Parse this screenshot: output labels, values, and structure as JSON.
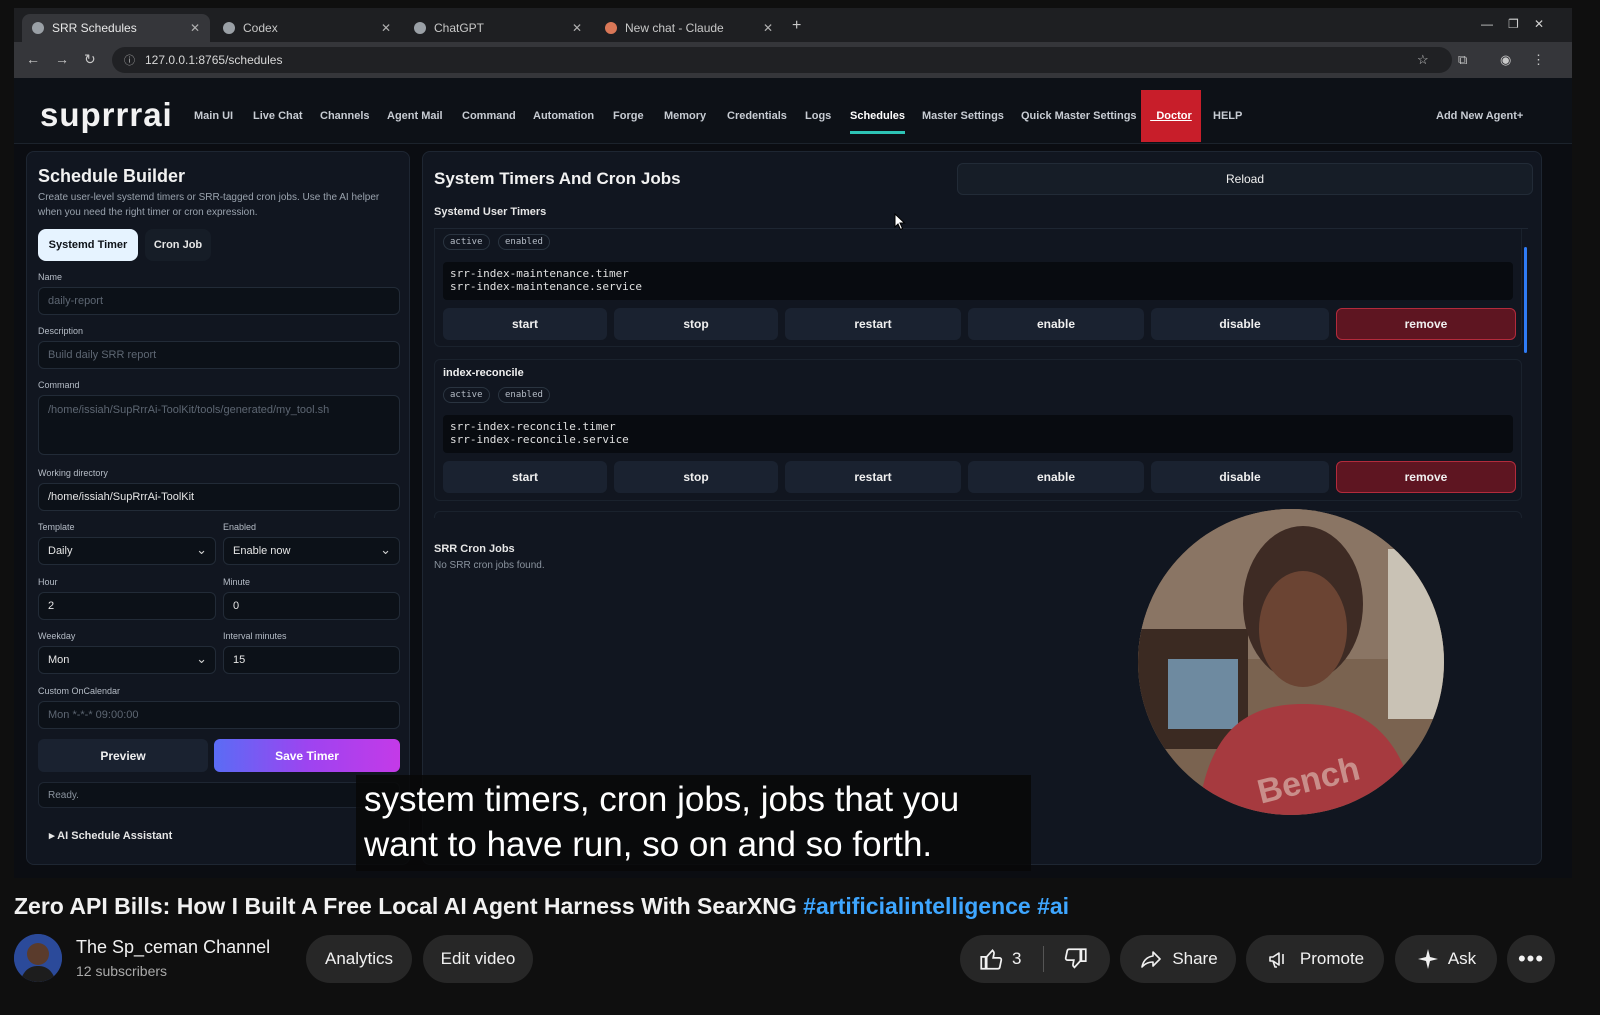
{
  "browser": {
    "tabs": [
      {
        "label": "SRR Schedules",
        "active": true
      },
      {
        "label": "Codex",
        "active": false
      },
      {
        "label": "ChatGPT",
        "active": false
      },
      {
        "label": "New chat - Claude",
        "active": false
      }
    ],
    "url": "127.0.0.1:8765/schedules"
  },
  "app": {
    "logo": "suprrrai",
    "nav": [
      "Main UI",
      "Live Chat",
      "Channels",
      "Agent Mail",
      "Command",
      "Automation",
      "Forge",
      "Memory",
      "Credentials",
      "Logs",
      "Schedules",
      "Master Settings",
      "Quick Master Settings",
      "_Doctor",
      "HELP"
    ],
    "active_nav": "Schedules",
    "add_agent": "Add New Agent+"
  },
  "builder": {
    "title": "Schedule Builder",
    "description": "Create user-level systemd timers or SRR-tagged cron jobs. Use the AI helper when you need the right timer or cron expression.",
    "mode_tabs": [
      "Systemd Timer",
      "Cron Job"
    ],
    "name_label": "Name",
    "name_placeholder": "daily-report",
    "desc_label": "Description",
    "desc_placeholder": "Build daily SRR report",
    "command_label": "Command",
    "command_placeholder": "/home/issiah/SupRrrAi-ToolKit/tools/generated/my_tool.sh",
    "workdir_label": "Working directory",
    "workdir_value": "/home/issiah/SupRrrAi-ToolKit",
    "template_label": "Template",
    "template_value": "Daily",
    "enabled_label": "Enabled",
    "enabled_value": "Enable now",
    "hour_label": "Hour",
    "hour_value": "2",
    "minute_label": "Minute",
    "minute_value": "0",
    "weekday_label": "Weekday",
    "weekday_value": "Mon",
    "interval_label": "Interval minutes",
    "interval_value": "15",
    "oncal_label": "Custom OnCalendar",
    "oncal_placeholder": "Mon *-*-* 09:00:00",
    "preview_label": "Preview",
    "save_label": "Save Timer",
    "status_text": "Ready.",
    "assistant_label": "▸ AI Schedule Assistant"
  },
  "timers": {
    "title": "System Timers And Cron Jobs",
    "reload_label": "Reload",
    "systemd_heading": "Systemd User Timers",
    "actions": [
      "start",
      "stop",
      "restart",
      "enable",
      "disable",
      "remove"
    ],
    "items": [
      {
        "name": "",
        "badges": [
          "active",
          "enabled"
        ],
        "units": "srr-index-maintenance.timer\nsrr-index-maintenance.service"
      },
      {
        "name": "index-reconcile",
        "badges": [
          "active",
          "enabled"
        ],
        "units": "srr-index-reconcile.timer\nsrr-index-reconcile.service"
      }
    ],
    "cron_heading": "SRR Cron Jobs",
    "cron_empty": "No SRR cron jobs found."
  },
  "overlay": {
    "caption": "system timers, cron jobs, jobs that you want to have run, so on and so forth.",
    "webcam_shirt_text": "Bench"
  },
  "video": {
    "title": "Zero API Bills: How I Built A Free Local AI Agent Harness With SearXNG",
    "hashtags": "#artificialintelligence #ai",
    "channel": "The Sp_ceman Channel",
    "subscribers": "12 subscribers",
    "analytics_label": "Analytics",
    "edit_label": "Edit video",
    "likes": "3",
    "share_label": "Share",
    "promote_label": "Promote",
    "ask_label": "Ask",
    "accent_color": "#3ea6ff"
  }
}
